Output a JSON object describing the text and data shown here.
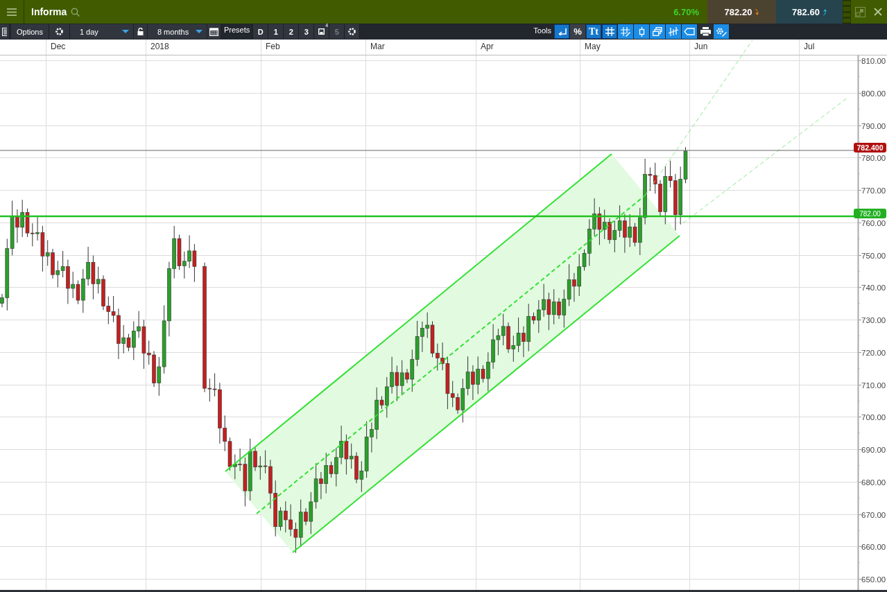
{
  "header": {
    "instrument": "Informa",
    "change": "6.70%",
    "sell": "782.20",
    "buy": "782.60"
  },
  "toolbar": {
    "options_label": "Options",
    "interval": "1 day",
    "period": "8 months",
    "presets_label": "Presets",
    "presets": [
      {
        "label": "D",
        "disabled": false
      },
      {
        "label": "1",
        "disabled": false
      },
      {
        "label": "2",
        "disabled": false
      },
      {
        "label": "3",
        "disabled": false
      },
      {
        "label": "5",
        "disabled": true
      }
    ],
    "save_badge": "4",
    "tools_label": "Tools",
    "tools": [
      {
        "kind": "back"
      },
      {
        "kind": "percent",
        "label": "%"
      },
      {
        "kind": "text",
        "label": "Tt"
      },
      {
        "kind": "grid"
      },
      {
        "kind": "draw"
      },
      {
        "kind": "candle"
      },
      {
        "kind": "windows"
      },
      {
        "kind": "bars"
      },
      {
        "kind": "tag"
      },
      {
        "kind": "print"
      },
      {
        "kind": "settings"
      }
    ]
  },
  "chart": {
    "x_labels": [
      "Dec",
      "2018",
      "Feb",
      "Mar",
      "Apr",
      "May",
      "Jun",
      "Jul"
    ],
    "y_labels": [
      "810.00",
      "800.00",
      "790.00",
      "780.00",
      "770.00",
      "760.00",
      "750.00",
      "740.00",
      "730.00",
      "720.00",
      "710.00",
      "700.00",
      "690.00",
      "680.00",
      "670.00",
      "660.00",
      "650.00"
    ],
    "price_tags": [
      {
        "kind": "last",
        "text": "782.400"
      },
      {
        "kind": "line",
        "text": "782.00"
      }
    ]
  }
}
